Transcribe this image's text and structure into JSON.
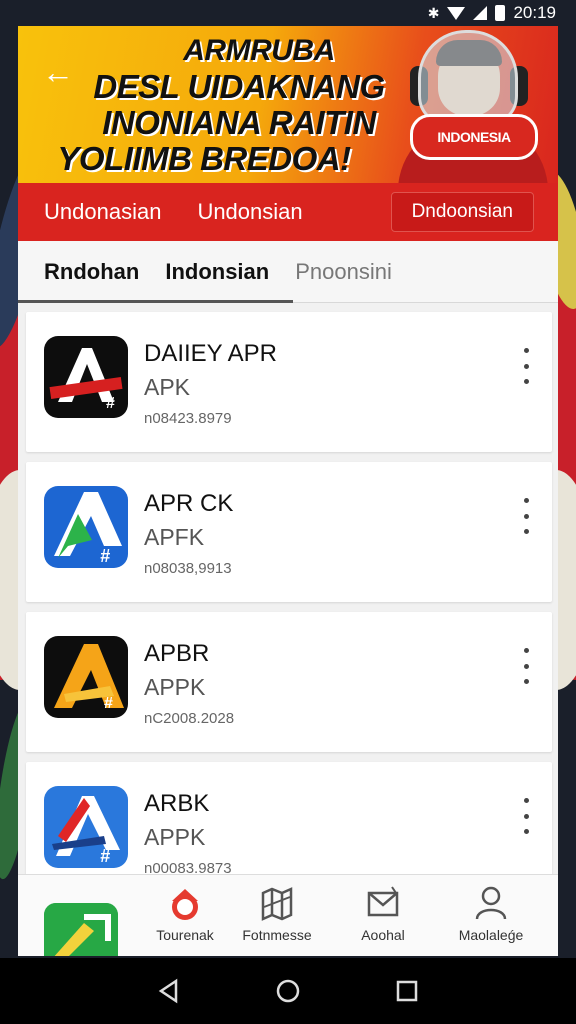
{
  "status_bar": {
    "time": "20:19"
  },
  "banner": {
    "headline_lines": [
      "ARMRUBA",
      "DESL UIDAKNANG",
      "INONIANA RAITIN",
      "YOLIIMB BREDOA!"
    ],
    "mascot_text": "INDONESIA"
  },
  "red_tabs": {
    "tab1": "Undonasian",
    "tab2": "Undonsian",
    "button": "Dndoonsian"
  },
  "tabs": {
    "tab1": "Rndohan",
    "tab2": "Indonsian",
    "tab3": "Pnoonsini"
  },
  "apps": [
    {
      "name": "DAIIEY APR",
      "kind": "APK",
      "version": "n08423.8979",
      "icon": "app-icon-a-black"
    },
    {
      "name": "APR CK",
      "kind": "APFK",
      "version": "n08038,9913",
      "icon": "app-icon-a-blue-green"
    },
    {
      "name": "APBR",
      "kind": "APPK",
      "version": "nC2008.2028",
      "icon": "app-icon-a-orange"
    },
    {
      "name": "ARBK",
      "kind": "APPK",
      "version": "n00083.9873",
      "icon": "app-icon-a-blue-red"
    }
  ],
  "bottom_nav": [
    {
      "label": "Tourenak",
      "icon": "home-icon"
    },
    {
      "label": "Fotnmesse",
      "icon": "map-icon"
    },
    {
      "label": "Aoohal",
      "icon": "mail-icon"
    },
    {
      "label": "Maolaleǵe",
      "icon": "profile-icon"
    }
  ],
  "colors": {
    "accent_red": "#d9241f",
    "banner_yellow": "#f8c20c"
  }
}
